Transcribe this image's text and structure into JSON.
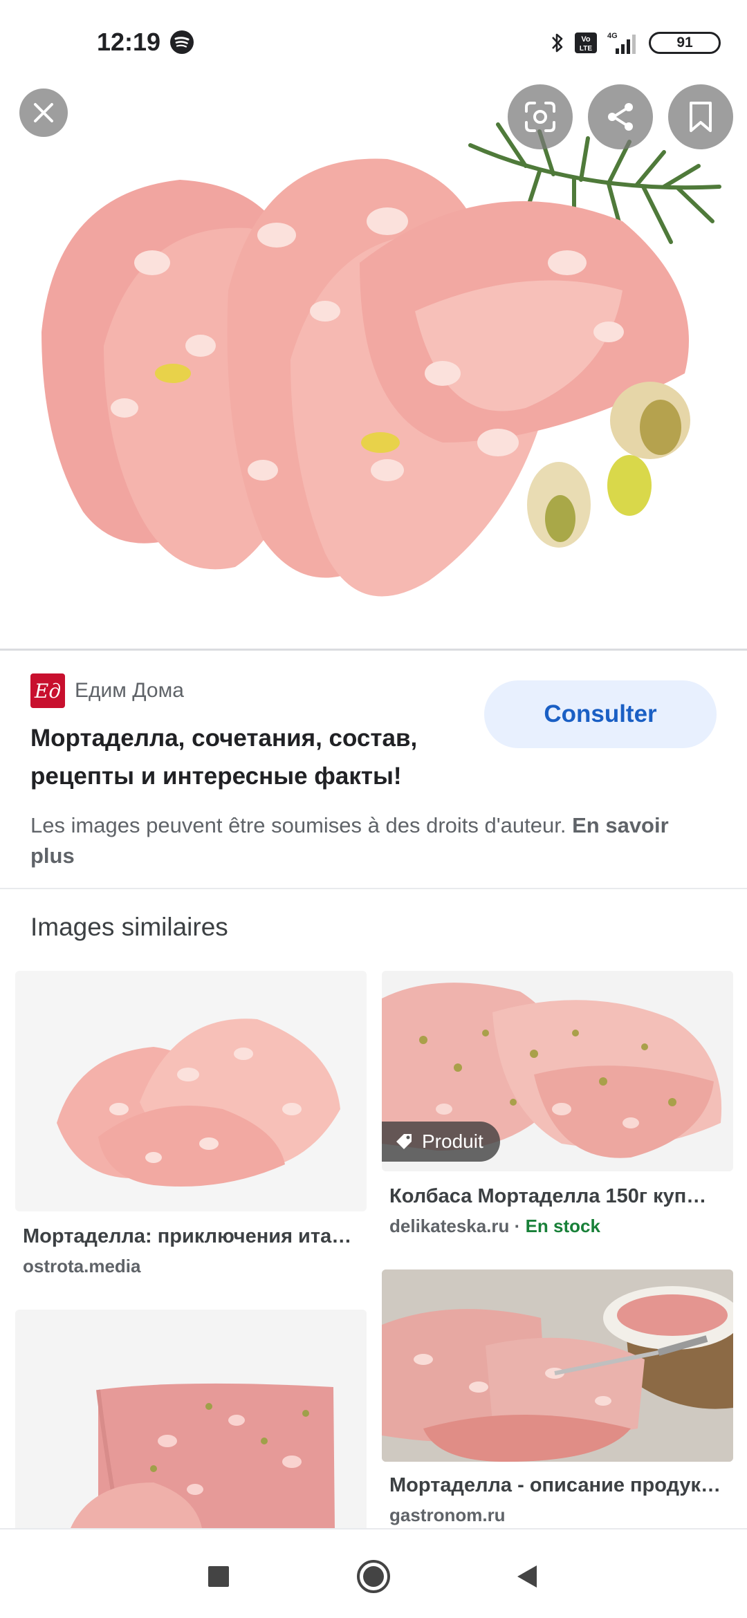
{
  "status_bar": {
    "time": "12:19",
    "battery": "91",
    "network": "4G",
    "icons": [
      "spotify-icon",
      "bluetooth-icon",
      "volte-icon",
      "signal-icon",
      "battery-icon"
    ]
  },
  "hero": {
    "buttons": [
      "close-icon",
      "lens-icon",
      "share-icon",
      "bookmark-icon"
    ]
  },
  "source": {
    "logo_text": "Ед",
    "name": "Едим Дома",
    "title": "Мортаделла, сочетания, состав, рецепты и интересные факты!",
    "consult_label": "Consulter",
    "copyright_text": "Les images peuvent être soumises à des droits d'auteur.",
    "learn_more": "En savoir plus"
  },
  "similar": {
    "heading": "Images similaires",
    "items": [
      {
        "caption": "Мортаделла: приключения ита…",
        "domain": "ostrota.media"
      },
      {
        "caption": "Колбаса Мортаделла 150г куп…",
        "domain": "delikateska.ru",
        "stock": "En stock",
        "badge": "Produit"
      },
      {
        "caption": "",
        "domain": ""
      },
      {
        "caption": "Мортаделла - описание продук…",
        "domain": "gastronom.ru"
      }
    ]
  },
  "nav": {
    "buttons": [
      "recents-icon",
      "home-icon",
      "back-icon"
    ]
  },
  "colors": {
    "accent": "#1a5fc4",
    "consult_bg": "#e8f0fe",
    "stock_green": "#188038",
    "source_logo": "#c8102e"
  }
}
